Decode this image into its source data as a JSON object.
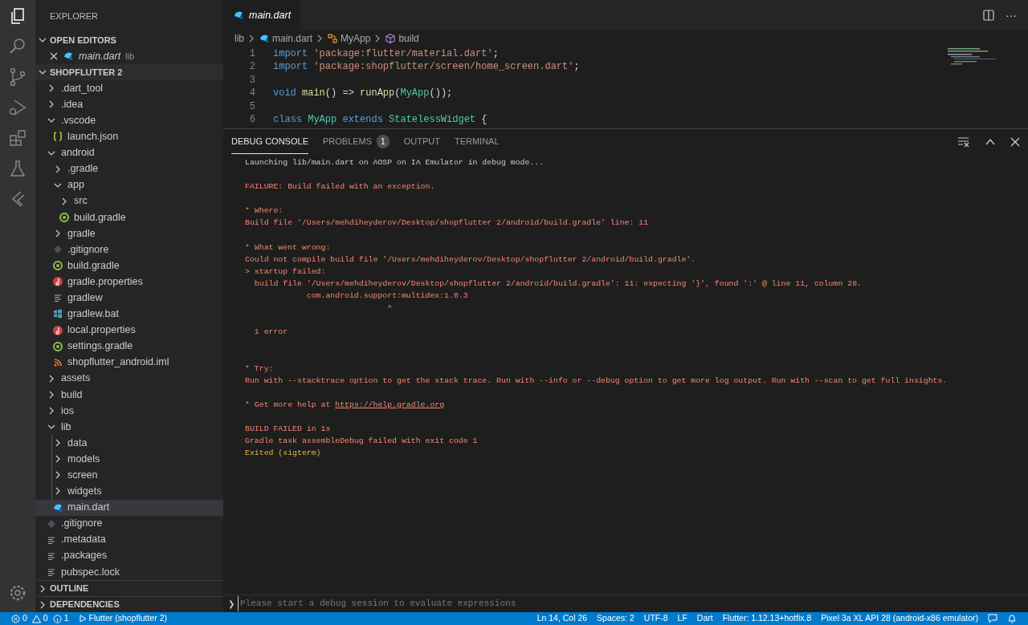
{
  "sidebar": {
    "title": "EXPLORER",
    "open_editors": {
      "label": "OPEN EDITORS",
      "expanded": true,
      "items": [
        {
          "name": "main.dart",
          "folder": "lib",
          "kind": "dart"
        }
      ]
    },
    "project": {
      "label": "SHOPFLUTTER 2",
      "expanded": true,
      "tree": [
        {
          "name": ".dart_tool",
          "kind": "folder",
          "expanded": false,
          "selected": false
        },
        {
          "name": ".idea",
          "kind": "folder",
          "expanded": false,
          "selected": false
        },
        {
          "name": ".vscode",
          "kind": "folder",
          "expanded": true,
          "selected": false,
          "children": [
            {
              "name": "launch.json",
              "kind": "json",
              "selected": false
            }
          ]
        },
        {
          "name": "android",
          "kind": "folder",
          "expanded": true,
          "selected": false,
          "children": [
            {
              "name": ".gradle",
              "kind": "folder",
              "expanded": false,
              "selected": false
            },
            {
              "name": "app",
              "kind": "folder",
              "expanded": true,
              "selected": false,
              "children": [
                {
                  "name": "src",
                  "kind": "folder",
                  "expanded": false,
                  "selected": false
                },
                {
                  "name": "build.gradle",
                  "kind": "gradle",
                  "selected": false
                }
              ]
            },
            {
              "name": "gradle",
              "kind": "folder",
              "expanded": false,
              "selected": false
            },
            {
              "name": ".gitignore",
              "kind": "git",
              "selected": false
            },
            {
              "name": "build.gradle",
              "kind": "gradle",
              "selected": false
            },
            {
              "name": "gradle.properties",
              "kind": "properties",
              "selected": false
            },
            {
              "name": "gradlew",
              "kind": "text",
              "selected": false
            },
            {
              "name": "gradlew.bat",
              "kind": "windows",
              "selected": false
            },
            {
              "name": "local.properties",
              "kind": "properties",
              "selected": false
            },
            {
              "name": "settings.gradle",
              "kind": "gradle",
              "selected": false
            },
            {
              "name": "shopflutter_android.iml",
              "kind": "feed",
              "selected": false
            }
          ]
        },
        {
          "name": "assets",
          "kind": "folder",
          "expanded": false,
          "selected": false
        },
        {
          "name": "build",
          "kind": "folder",
          "expanded": false,
          "selected": false
        },
        {
          "name": "ios",
          "kind": "folder",
          "expanded": false,
          "selected": false
        },
        {
          "name": "lib",
          "kind": "folder",
          "expanded": true,
          "selected": false,
          "children": [
            {
              "name": "data",
              "kind": "folder",
              "expanded": false,
              "selected": false
            },
            {
              "name": "models",
              "kind": "folder",
              "expanded": false,
              "selected": false
            },
            {
              "name": "screen",
              "kind": "folder",
              "expanded": false,
              "selected": false
            },
            {
              "name": "widgets",
              "kind": "folder",
              "expanded": false,
              "selected": false
            },
            {
              "name": "main.dart",
              "kind": "dart",
              "selected": true
            }
          ]
        },
        {
          "name": ".gitignore",
          "kind": "git",
          "selected": false
        },
        {
          "name": ".metadata",
          "kind": "text",
          "selected": false
        },
        {
          "name": ".packages",
          "kind": "text",
          "selected": false
        },
        {
          "name": "pubspec.lock",
          "kind": "text",
          "selected": false
        }
      ]
    },
    "bottom_sections": [
      {
        "label": "OUTLINE",
        "expanded": false
      },
      {
        "label": "DEPENDENCIES",
        "expanded": false
      }
    ]
  },
  "editor": {
    "tabs": [
      {
        "label": "main.dart",
        "kind": "dart",
        "selected": true
      }
    ],
    "more_label": "···",
    "breadcrumbs": [
      {
        "label": "lib",
        "kind": "folder"
      },
      {
        "label": "main.dart",
        "kind": "dart"
      },
      {
        "label": "MyApp",
        "kind": "class"
      },
      {
        "label": "build",
        "kind": "method"
      }
    ],
    "code": [
      {
        "number": "1",
        "tokens": [
          {
            "kind": "keyword",
            "text": "import "
          },
          {
            "kind": "string",
            "text": "'package:flutter/material.dart'"
          },
          {
            "kind": "plain",
            "text": ";"
          }
        ]
      },
      {
        "number": "2",
        "tokens": [
          {
            "kind": "keyword",
            "text": "import "
          },
          {
            "kind": "string",
            "text": "'package:shopflutter/screen/home_screen.dart'"
          },
          {
            "kind": "plain",
            "text": ";"
          }
        ]
      },
      {
        "number": "3"
      },
      {
        "number": "4",
        "tokens": [
          {
            "kind": "keyword",
            "text": "void "
          },
          {
            "kind": "func",
            "text": "main"
          },
          {
            "kind": "plain",
            "text": "() => "
          },
          {
            "kind": "func",
            "text": "runApp"
          },
          {
            "kind": "plain",
            "text": "("
          },
          {
            "kind": "class",
            "text": "MyApp"
          },
          {
            "kind": "plain",
            "text": "());"
          }
        ]
      },
      {
        "number": "5"
      },
      {
        "number": "6",
        "tokens": [
          {
            "kind": "keyword",
            "text": "class "
          },
          {
            "kind": "class",
            "text": "MyApp "
          },
          {
            "kind": "keyword",
            "text": "extends "
          },
          {
            "kind": "class",
            "text": "StatelessWidget"
          },
          {
            "kind": "plain",
            "text": " {"
          }
        ]
      }
    ]
  },
  "panel": {
    "tabs": [
      {
        "label": "DEBUG CONSOLE",
        "selected": true
      },
      {
        "label": "PROBLEMS",
        "selected": false,
        "count": "1"
      },
      {
        "label": "OUTPUT",
        "selected": false
      },
      {
        "label": "TERMINAL",
        "selected": false
      }
    ],
    "console": [
      {
        "kind": "info",
        "text": "Launching lib/main.dart on AOSP on IA Emulator in debug mode..."
      },
      {
        "kind": "error",
        "gap_before": true,
        "text": "FAILURE: Build failed with an exception."
      },
      {
        "kind": "error",
        "gap_before": true,
        "text": "* Where:"
      },
      {
        "kind": "error",
        "text": "Build file '/Users/mehdiheyderov/Desktop/shopflutter 2/android/build.gradle' line: 11"
      },
      {
        "kind": "error",
        "gap_before": true,
        "text": "* What went wrong:"
      },
      {
        "kind": "error",
        "text": "Could not compile build file '/Users/mehdiheyderov/Desktop/shopflutter 2/android/build.gradle'."
      },
      {
        "kind": "error",
        "text": "> startup failed:"
      },
      {
        "kind": "error",
        "text": "  build file '/Users/mehdiheyderov/Desktop/shopflutter 2/android/build.gradle': 11: expecting '}', found ':' @ line 11, column 28."
      },
      {
        "kind": "error",
        "text": "             com.android.support:multidex:1.0.3"
      },
      {
        "kind": "error",
        "text": "                              ^"
      },
      {
        "kind": "error",
        "gap_before": true,
        "text": "  1 error"
      },
      {
        "kind": "error",
        "gap_before": true,
        "extra_gap": true,
        "text": "* Try:"
      },
      {
        "kind": "error",
        "text": "Run with --stacktrace option to get the stack trace. Run with --info or --debug option to get more log output. Run with --scan to get full insights."
      },
      {
        "kind": "error",
        "gap_before": true,
        "text": "* Get more help at ",
        "link": "https://help.gradle.org"
      },
      {
        "kind": "error",
        "gap_before": true,
        "text": "BUILD FAILED in 1s"
      },
      {
        "kind": "error",
        "text": "Gradle task assembleDebug failed with exit code 1"
      },
      {
        "kind": "warning",
        "text": "Exited (sigterm)"
      }
    ],
    "input": {
      "prompt": "❯",
      "placeholder": "Please start a debug session to evaluate expressions"
    }
  },
  "status_bar": {
    "errors": "0",
    "warnings": "0",
    "infos": "1",
    "debug_target": "Flutter (shopflutter 2)",
    "right": [
      "Ln 14, Col 26",
      "Spaces: 2",
      "UTF-8",
      "LF",
      "Dart",
      "Flutter: 1.12.13+hotfix.8",
      "Pixel 3a XL API 28 (android-x86 emulator)"
    ]
  }
}
